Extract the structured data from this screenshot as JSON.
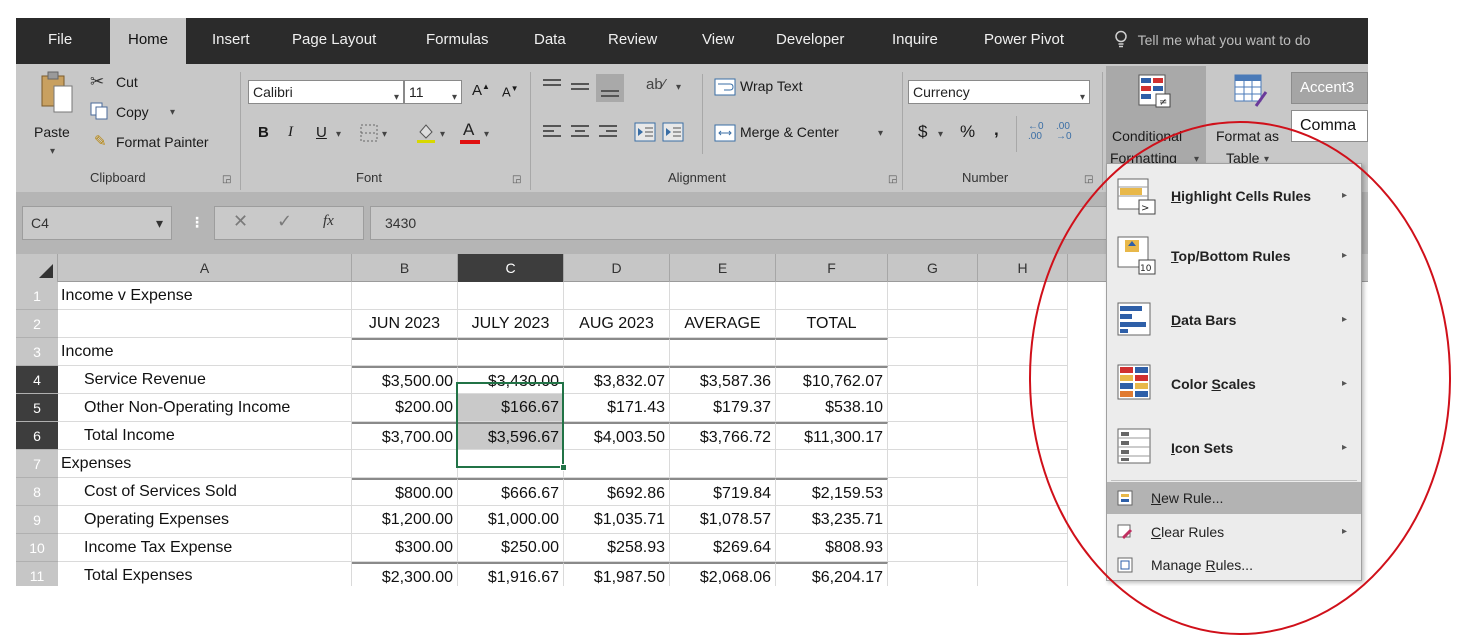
{
  "menubar": {
    "tabs": [
      "File",
      "Home",
      "Insert",
      "Page Layout",
      "Formulas",
      "Data",
      "Review",
      "View",
      "Developer",
      "Inquire",
      "Power Pivot"
    ],
    "tell_me": "Tell me what you want to do"
  },
  "ribbon": {
    "clipboard": {
      "paste": "Paste",
      "cut": "Cut",
      "copy": "Copy",
      "format_painter": "Format Painter",
      "label": "Clipboard"
    },
    "font": {
      "name": "Calibri",
      "size": "11",
      "bold": "B",
      "italic": "I",
      "underline": "U",
      "label": "Font"
    },
    "alignment": {
      "wrap_text": "Wrap Text",
      "merge_center": "Merge & Center",
      "label": "Alignment"
    },
    "number": {
      "format": "Currency",
      "dollar": "$",
      "percent": "%",
      "comma": ",",
      "label": "Number"
    },
    "styles": {
      "conditional_formatting_1": "Conditional",
      "conditional_formatting_2": "Formatting",
      "format_as_table_1": "Format as",
      "format_as_table_2": "Table",
      "accent": "Accent3",
      "comma_style": "Comma"
    }
  },
  "formula_bar": {
    "name_box": "C4",
    "fx": "fx",
    "value": "3430"
  },
  "sheet": {
    "columns": [
      "A",
      "B",
      "C",
      "D",
      "E",
      "F",
      "G",
      "H"
    ],
    "rows": [
      {
        "num": "1",
        "a": "Income v Expense",
        "b": "",
        "c": "",
        "d": "",
        "e": "",
        "f": ""
      },
      {
        "num": "2",
        "a": "",
        "b": "JUN 2023",
        "c": "JULY 2023",
        "d": "AUG 2023",
        "e": "AVERAGE",
        "f": "TOTAL"
      },
      {
        "num": "3",
        "a": "Income",
        "b": "",
        "c": "",
        "d": "",
        "e": "",
        "f": ""
      },
      {
        "num": "4",
        "a": "Service Revenue",
        "b": "$3,500.00",
        "c": "$3,430.00",
        "d": "$3,832.07",
        "e": "$3,587.36",
        "f": "$10,762.07"
      },
      {
        "num": "5",
        "a": "Other Non-Operating Income",
        "b": "$200.00",
        "c": "$166.67",
        "d": "$171.43",
        "e": "$179.37",
        "f": "$538.10"
      },
      {
        "num": "6",
        "a": "Total Income",
        "b": "$3,700.00",
        "c": "$3,596.67",
        "d": "$4,003.50",
        "e": "$3,766.72",
        "f": "$11,300.17"
      },
      {
        "num": "7",
        "a": "Expenses",
        "b": "",
        "c": "",
        "d": "",
        "e": "",
        "f": ""
      },
      {
        "num": "8",
        "a": "Cost of Services Sold",
        "b": "$800.00",
        "c": "$666.67",
        "d": "$692.86",
        "e": "$719.84",
        "f": "$2,159.53"
      },
      {
        "num": "9",
        "a": "Operating Expenses",
        "b": "$1,200.00",
        "c": "$1,000.00",
        "d": "$1,035.71",
        "e": "$1,078.57",
        "f": "$3,235.71"
      },
      {
        "num": "10",
        "a": "Income Tax Expense",
        "b": "$300.00",
        "c": "$250.00",
        "d": "$258.93",
        "e": "$269.64",
        "f": "$808.93"
      },
      {
        "num": "11",
        "a": "Total Expenses",
        "b": "$2,300.00",
        "c": "$1,916.67",
        "d": "$1,987.50",
        "e": "$2,068.06",
        "f": "$6,204.17"
      }
    ]
  },
  "cf_menu": {
    "highlight": {
      "key": "H",
      "rest": "ighlight Cells Rules"
    },
    "topbottom": {
      "key": "T",
      "rest": "op/Bottom Rules"
    },
    "databars": {
      "key": "D",
      "rest": "ata Bars"
    },
    "colorscales_pre": "Color ",
    "colorscales_key": "S",
    "colorscales_post": "cales",
    "iconsets": {
      "key": "I",
      "rest": "con Sets"
    },
    "newrule": {
      "key": "N",
      "rest": "ew Rule..."
    },
    "clearrules": {
      "key": "C",
      "rest": "lear Rules"
    },
    "managerules_pre": "Manage ",
    "managerules_key": "R",
    "managerules_post": "ules..."
  },
  "annotation_color": "#d0101a"
}
